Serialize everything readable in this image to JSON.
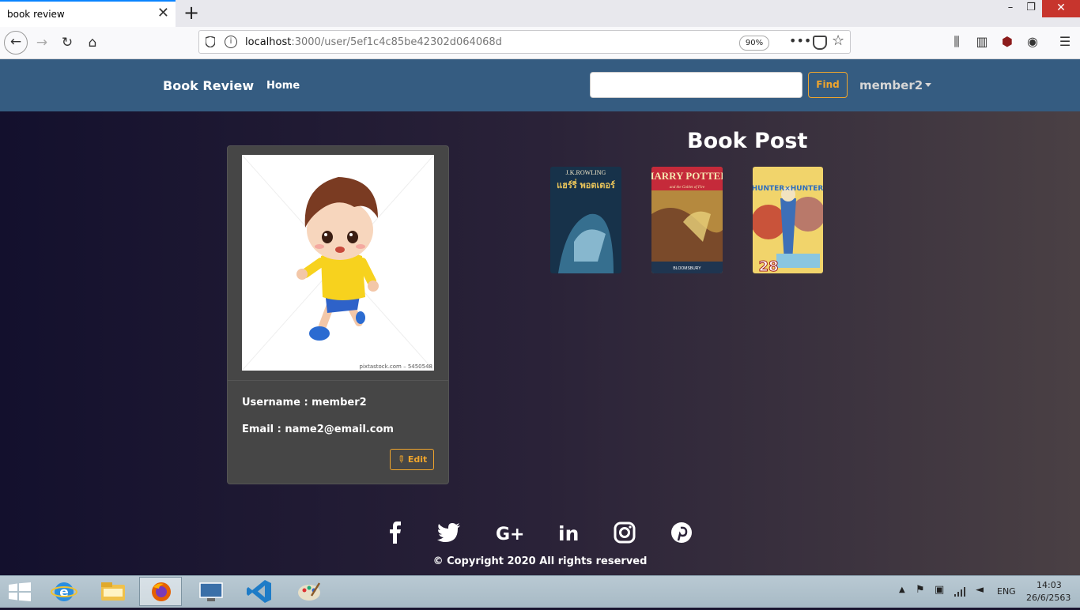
{
  "browser": {
    "tab_title": "book review",
    "url_host": "localhost",
    "url_rest": ":3000/user/5ef1c4c85be42302d064068d",
    "zoom": "90%"
  },
  "site": {
    "brand": "Book Review",
    "nav_home": "Home",
    "search_placeholder": "",
    "find_label": "Find",
    "user_menu": "member2"
  },
  "profile": {
    "avatar_caption": "pixtastock.com – 5450548",
    "username_line": "Username : member2",
    "email_line": "Email : name2@email.com",
    "edit_label": "Edit"
  },
  "posts": {
    "title": "Book Post",
    "books": [
      {
        "cover_author": "J.K.ROWLING",
        "cover_title": "แฮร์รี่ พอตเตอร์",
        "colors": [
          "#17324a",
          "#3f7ea0"
        ]
      },
      {
        "cover_author": "",
        "cover_title": "HARRY POTTER",
        "cover_subtitle": "and the Goblet of Fire",
        "cover_footer": "BLOOMSBURY",
        "colors": [
          "#c52a3a",
          "#b5893e"
        ]
      },
      {
        "cover_title": "HUNTER×HUNTER",
        "cover_number": "28",
        "colors": [
          "#f1d46b",
          "#c9533a"
        ]
      }
    ]
  },
  "footer": {
    "socials": [
      "facebook-icon",
      "twitter-icon",
      "google-plus-icon",
      "linkedin-icon",
      "instagram-icon",
      "pinterest-icon"
    ],
    "copyright": "© Copyright 2020 All rights reserved"
  },
  "taskbar": {
    "language": "ENG",
    "time": "14:03",
    "date": "26/6/2563",
    "apps": [
      "internet-explorer-icon",
      "file-explorer-icon",
      "firefox-icon",
      "remote-desktop-icon",
      "vscode-icon",
      "paint-icon"
    ]
  }
}
